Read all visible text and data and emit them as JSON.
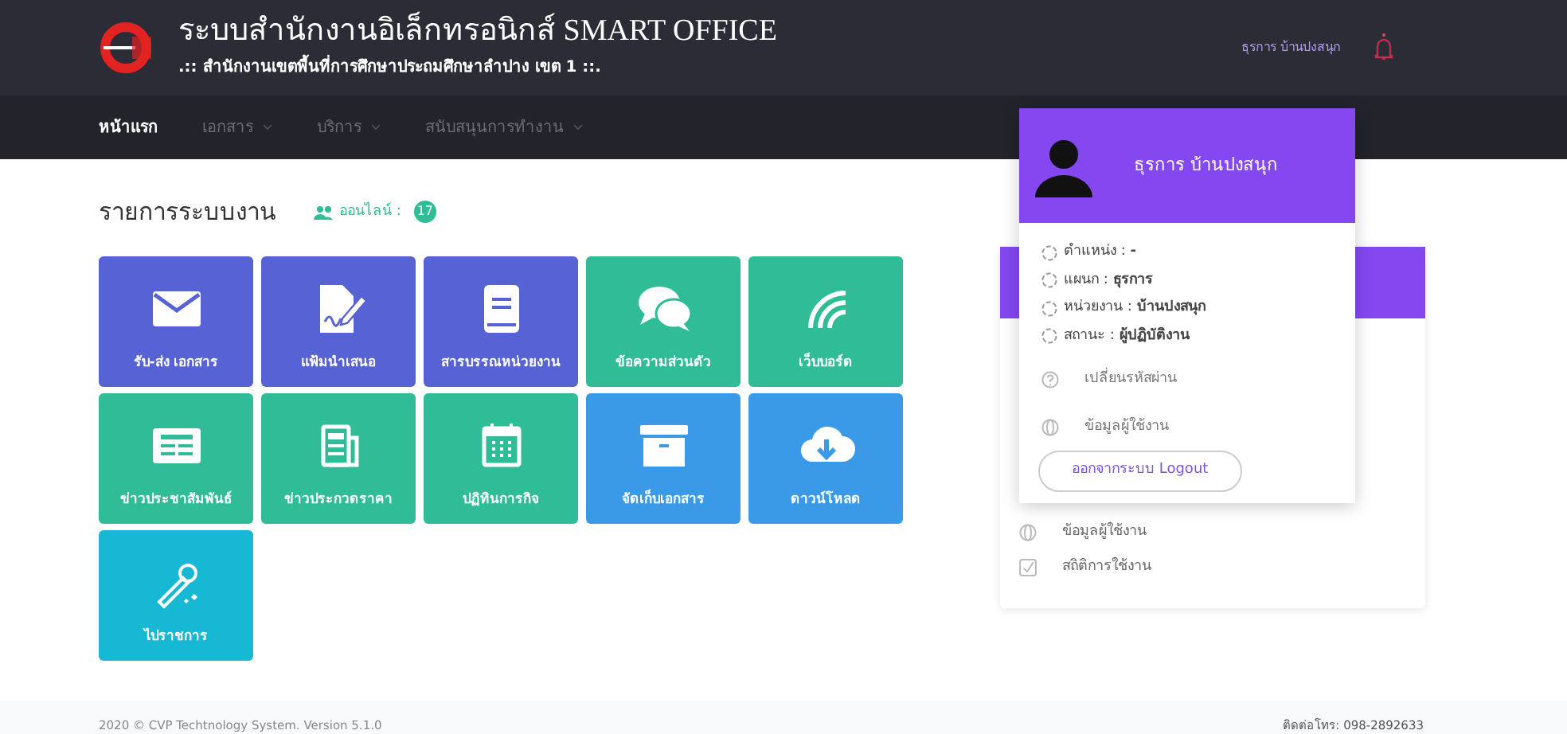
{
  "header": {
    "title": "ระบบสำนักงานอิเล็กทรอนิกส์ SMART OFFICE",
    "subtitle": ".:: สำนักงานเขตพื้นที่การศึกษาประถมศึกษาลำปาง เขต 1 ::.",
    "user_name": "ธุรการ บ้านปงสนุก"
  },
  "nav": [
    {
      "label": "หน้าแรก",
      "selected": true,
      "dropdown": false
    },
    {
      "label": "เอกสาร",
      "selected": false,
      "dropdown": true
    },
    {
      "label": "บริการ",
      "selected": false,
      "dropdown": true
    },
    {
      "label": "สนับสนุนการทำงาน",
      "selected": false,
      "dropdown": true
    }
  ],
  "section": {
    "title": "รายการระบบงาน",
    "online_label": "ออนไลน์ :",
    "online_count": "17"
  },
  "tiles": [
    {
      "label": "รับ-ส่ง เอกสาร",
      "kind": "envelope",
      "color": "#5762d5"
    },
    {
      "label": "แฟ้มนำเสนอ",
      "kind": "sign",
      "color": "#5762d5"
    },
    {
      "label": "สารบรรณหน่วยงาน",
      "kind": "book",
      "color": "#5762d5"
    },
    {
      "label": "ข้อความส่วนตัว",
      "kind": "chat",
      "color": "#2fbc96"
    },
    {
      "label": "เว็บบอร์ด",
      "kind": "board",
      "color": "#2fbc96"
    },
    {
      "label": "ข่าวประชาสัมพันธ์",
      "kind": "news",
      "color": "#2fbc96"
    },
    {
      "label": "ข่าวประกวดราคา",
      "kind": "paper",
      "color": "#2fbc96"
    },
    {
      "label": "ปฏิทินการกิจ",
      "kind": "calendar",
      "color": "#2fbc96"
    },
    {
      "label": "จัดเก็บเอกสาร",
      "kind": "archive",
      "color": "#3a9ae8"
    },
    {
      "label": "ดาวน์โหลด",
      "kind": "download",
      "color": "#3a9ae8"
    },
    {
      "label": "ไปราชการ",
      "kind": "wand",
      "color": "#17b8d4"
    }
  ],
  "card_menu": [
    {
      "label": "ข้อมูลผู้ใช้งาน",
      "kind": "globe"
    },
    {
      "label": "สถิติการใช้งาน",
      "kind": "check"
    }
  ],
  "user_dropdown": {
    "name": "ธุรการ บ้านปงสนุก",
    "details": [
      {
        "label": "ตำแหน่ง :",
        "value": "-"
      },
      {
        "label": "แผนก :",
        "value": "ธุรการ"
      },
      {
        "label": "หน่วยงาน :",
        "value": "บ้านปงสนุก"
      },
      {
        "label": "สถานะ :",
        "value": "ผู้ปฏิบัติงาน"
      }
    ],
    "links": [
      {
        "label": "เปลี่ยนรหัสผ่าน",
        "kind": "help"
      },
      {
        "label": "ข้อมูลผู้ใช้งาน",
        "kind": "globe"
      }
    ],
    "logout": "ออกจากระบบ Logout"
  },
  "footer": {
    "copyright": "2020 © CVP Techtnology System. Version 5.1.0",
    "contact": "ติดต่อโทร: 098-2892633"
  }
}
